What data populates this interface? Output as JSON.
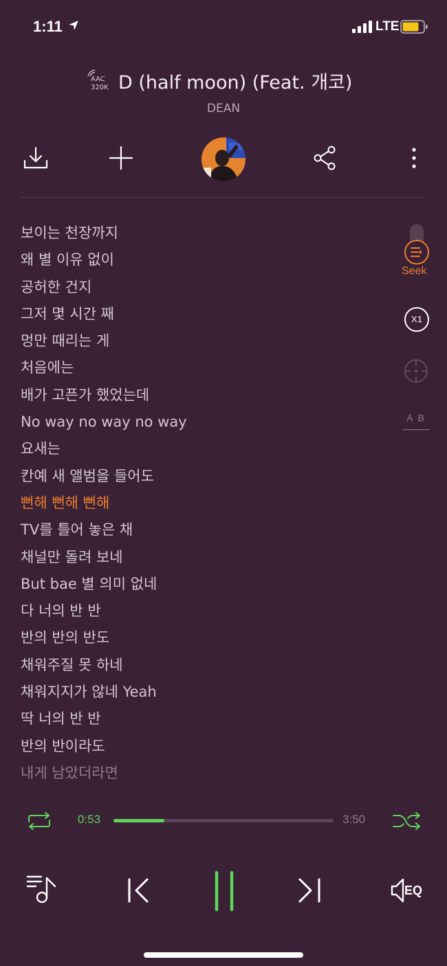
{
  "status": {
    "time": "1:11",
    "network": "LTE"
  },
  "player": {
    "quality_line1": "AAC",
    "quality_line2": "320K",
    "title": "D (half moon) (Feat. 개코)",
    "artist": "DEAN"
  },
  "lyrics": [
    "보이는 천장까지",
    "왜 별 이유 없이",
    "공허한 건지",
    "그저 몇 시간 째",
    "멍만 때리는 게",
    "처음에는",
    "배가 고픈가 했었는데",
    "No way no way no way",
    "요새는",
    "칸예 새 앨범을 들어도",
    "뻔해 뻔해 뻔해",
    "TV를 틀어 놓은 채",
    "채널만 돌려 보네",
    "But bae 별 의미 없네",
    "다 너의 반 반",
    "반의 반의 반도",
    "채워주질 못 하네",
    "채워지지가 않네 Yeah",
    "딱 너의 반 반",
    "반의 반이라도",
    "내게 남았더라면"
  ],
  "active_lyric_index": 10,
  "side": {
    "seek_label": "Seek",
    "speed_label": "X1",
    "ab_label": "A B"
  },
  "progress": {
    "current": "0:53",
    "total": "3:50",
    "fraction": 0.23
  },
  "colors": {
    "background": "#3a2136",
    "accent_orange": "#ee7f2d",
    "accent_green": "#5fd35a"
  },
  "icons": [
    "download-icon",
    "add-icon",
    "share-icon",
    "more-icon",
    "repeat-icon",
    "shuffle-icon",
    "playlist-icon",
    "previous-icon",
    "pause-icon",
    "next-icon",
    "eq-icon"
  ]
}
